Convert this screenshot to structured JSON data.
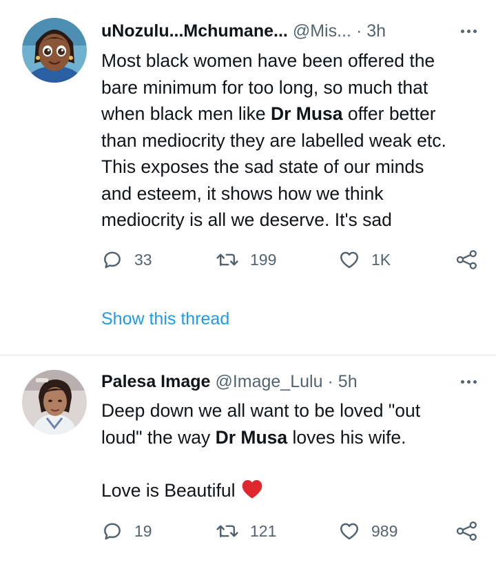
{
  "tweets": [
    {
      "display_name": "uNozulu...Mchumane...",
      "handle": "@Mis...",
      "separator": "·",
      "time": "3h",
      "avatar_icon": "avatar-cartoon-woman",
      "body_lines": [
        "Most black women have been offered the",
        "bare minimum for too long, so much that",
        "when black men like ",
        "Dr Musa",
        " offer better",
        "than mediocrity they are labelled weak etc.",
        "This exposes the sad state of our minds",
        "and esteem, it shows how we think",
        "mediocrity is all we deserve. It's sad"
      ],
      "reply_count": "33",
      "retweet_count": "199",
      "like_count": "1K",
      "show_thread": "Show this thread"
    },
    {
      "display_name": "Palesa Image",
      "handle": "@Image_Lulu",
      "separator": "·",
      "time": "5h",
      "avatar_icon": "avatar-photo-woman",
      "body_lines": [
        "Deep down we all want to be loved \"out",
        "loud\" the way ",
        "Dr Musa",
        " loves his wife.",
        "Love is Beautiful"
      ],
      "reply_count": "19",
      "retweet_count": "121",
      "like_count": "989"
    }
  ],
  "colors": {
    "text": "#0f1419",
    "secondary": "#536471",
    "link": "#1d9bf0",
    "heart_emoji": "#e0262e",
    "divider": "#e4e8eb"
  },
  "icons": [
    "reply-icon",
    "retweet-icon",
    "like-icon",
    "share-icon",
    "more-options-icon",
    "red-heart-emoji"
  ]
}
